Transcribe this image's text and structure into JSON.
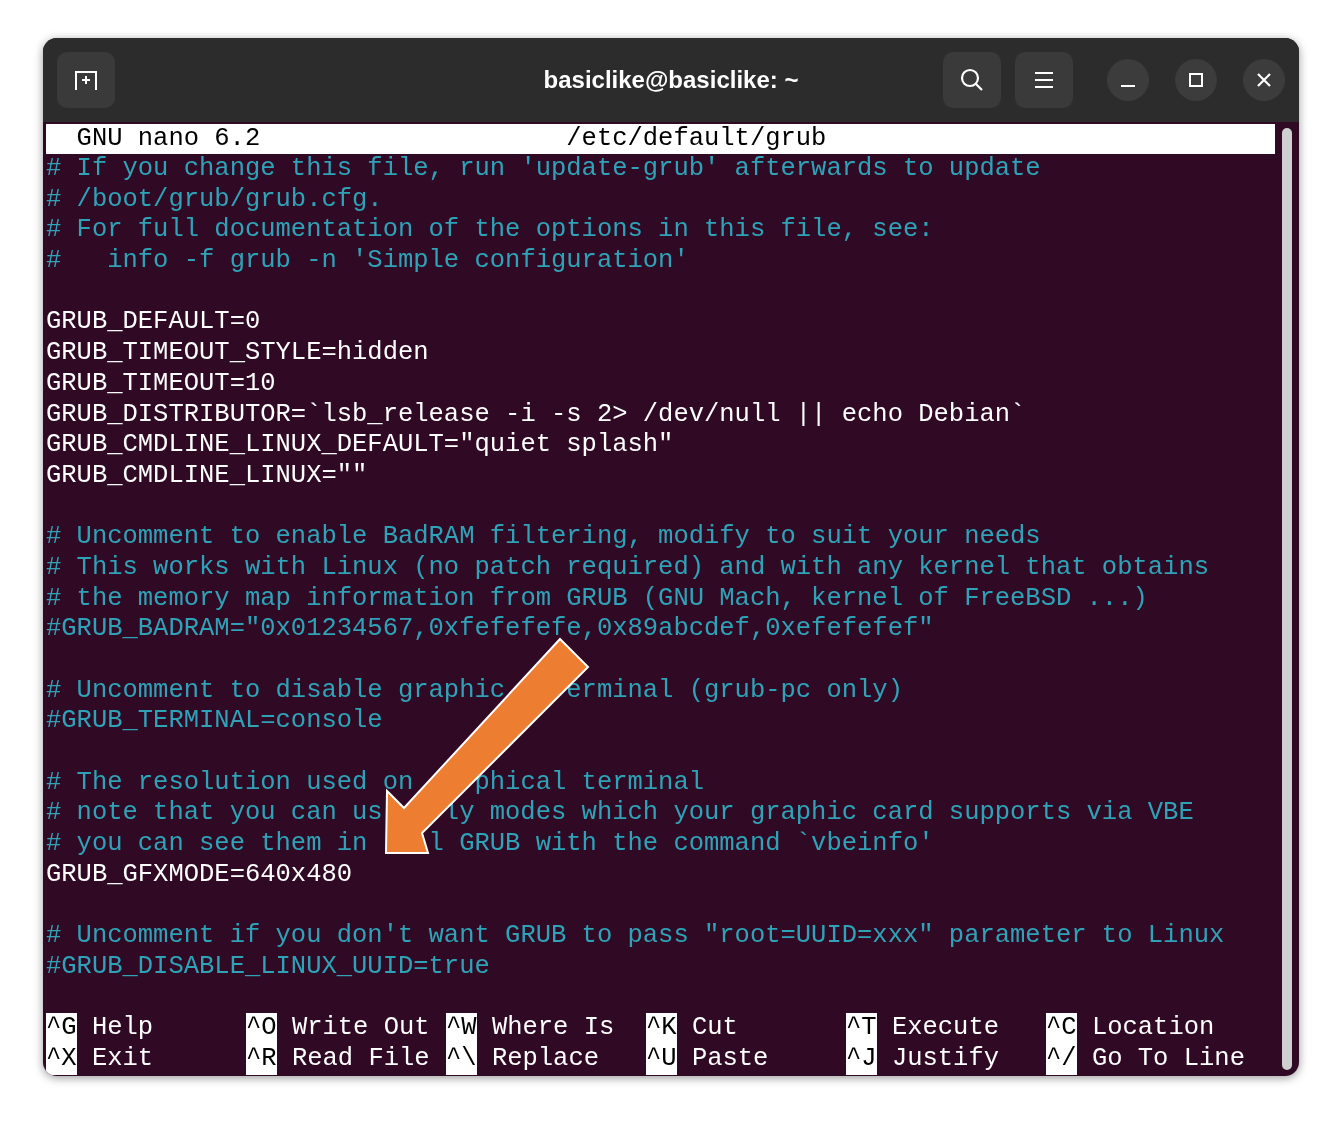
{
  "window": {
    "title": "basiclike@basiclike: ~"
  },
  "nano_header": {
    "version": "GNU nano 6.2",
    "file": "/etc/default/grub"
  },
  "lines": [
    {
      "kind": "comment",
      "segments": [
        "# If you change this file, run 'update-grub' afterwards to update"
      ]
    },
    {
      "kind": "comment",
      "segments": [
        "# /boot/grub/grub.cfg."
      ]
    },
    {
      "kind": "comment",
      "segments": [
        "# For full documentation of the options in this file, see:"
      ]
    },
    {
      "kind": "comment",
      "segments": [
        "#   info -f grub -n 'Simple configuration'"
      ]
    },
    {
      "kind": "blank"
    },
    {
      "kind": "setting",
      "segments": [
        "GRUB_DEFAULT=0"
      ]
    },
    {
      "kind": "setting",
      "segments": [
        "GRUB_TIMEOUT_STYLE=hidden"
      ]
    },
    {
      "kind": "setting",
      "segments": [
        "GRUB_TIMEOUT=10"
      ]
    },
    {
      "kind": "setting",
      "segments": [
        "GRUB_DISTRIBUTOR=`lsb_release -i -s 2> /dev/null || echo Debian`"
      ]
    },
    {
      "kind": "setting",
      "segments": [
        "GRUB_CMDLINE_LINUX_DEFAULT=\"quiet splash\""
      ]
    },
    {
      "kind": "setting",
      "segments": [
        "GRUB_CMDLINE_LINUX=\"\""
      ]
    },
    {
      "kind": "blank"
    },
    {
      "kind": "comment",
      "segments": [
        "# Uncomment to enable BadRAM filtering, modify to suit your needs"
      ]
    },
    {
      "kind": "comment",
      "segments": [
        "# This works with Linux (no patch required) and with any kernel that obtains"
      ]
    },
    {
      "kind": "comment",
      "segments": [
        "# the memory map information from GRUB (GNU Mach, kernel of FreeBSD ...)"
      ]
    },
    {
      "kind": "comment",
      "segments": [
        "#GRUB_BADRAM=\"0x01234567,0xfefefefe,0x89abcdef,0xefefefef\""
      ]
    },
    {
      "kind": "blank"
    },
    {
      "kind": "comment",
      "segments": [
        "# Uncomment to disable graphic",
        "erminal (grub-pc only)"
      ]
    },
    {
      "kind": "comment",
      "segments": [
        "#GRUB_TERMINAL=console"
      ]
    },
    {
      "kind": "blank"
    },
    {
      "kind": "comment",
      "segments": [
        "# The resolution used on",
        "phical terminal"
      ]
    },
    {
      "kind": "comment",
      "segments": [
        "# note that you can us",
        "ly modes which your graphic card supports via VBE"
      ]
    },
    {
      "kind": "comment",
      "segments": [
        "# you can see them in",
        "l GRUB with the command `vbeinfo'"
      ]
    },
    {
      "kind": "setting",
      "segments": [
        "GRUB_GFXMODE=640x480"
      ]
    },
    {
      "kind": "blank"
    },
    {
      "kind": "comment",
      "segments": [
        "# Uncomment if you don't want GRUB to pass \"root=UUID=xxx\" parameter to Linux"
      ]
    },
    {
      "kind": "comment",
      "segments": [
        "#GRUB_DISABLE_LINUX_UUID=true"
      ]
    }
  ],
  "shortcuts": [
    {
      "key": "^G",
      "label": "Help"
    },
    {
      "key": "^O",
      "label": "Write Out"
    },
    {
      "key": "^W",
      "label": "Where Is"
    },
    {
      "key": "^K",
      "label": "Cut"
    },
    {
      "key": "^T",
      "label": "Execute"
    },
    {
      "key": "^C",
      "label": "Location"
    },
    {
      "key": "^X",
      "label": "Exit"
    },
    {
      "key": "^R",
      "label": "Read File"
    },
    {
      "key": "^\\",
      "label": "Replace"
    },
    {
      "key": "^U",
      "label": "Paste"
    },
    {
      "key": "^J",
      "label": "Justify"
    },
    {
      "key": "^/",
      "label": "Go To Line"
    }
  ]
}
